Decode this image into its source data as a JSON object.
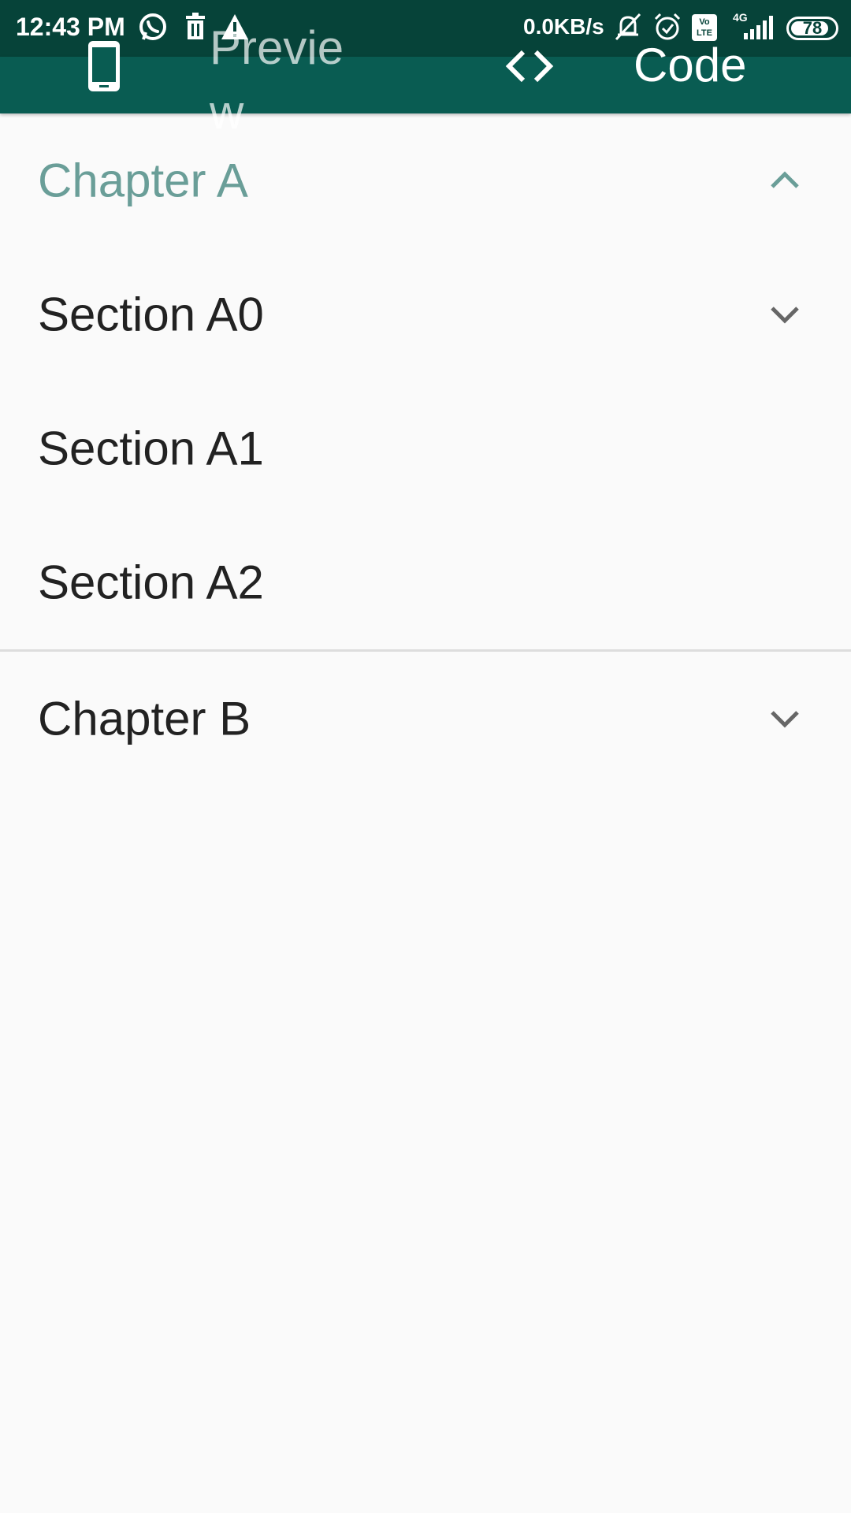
{
  "status_bar": {
    "time": "12:43 PM",
    "network_speed": "0.0KB/s",
    "network_type": "4G",
    "volte": "Vo LTE",
    "battery": "78"
  },
  "tabs": [
    {
      "label": "Preview",
      "icon": "phone-icon"
    },
    {
      "label": "Code",
      "icon": "code-icon"
    }
  ],
  "accordion": {
    "chapter_a": {
      "label": "Chapter A",
      "expanded": true
    },
    "sections": [
      {
        "label": "Section A0",
        "has_children": true
      },
      {
        "label": "Section A1"
      },
      {
        "label": "Section A2"
      }
    ],
    "chapter_b": {
      "label": "Chapter B",
      "expanded": false
    }
  },
  "colors": {
    "status_bar": "#064339",
    "app_bar": "#095c52",
    "active_header": "#6a9e98",
    "text": "#222222",
    "background": "#fafafa"
  }
}
